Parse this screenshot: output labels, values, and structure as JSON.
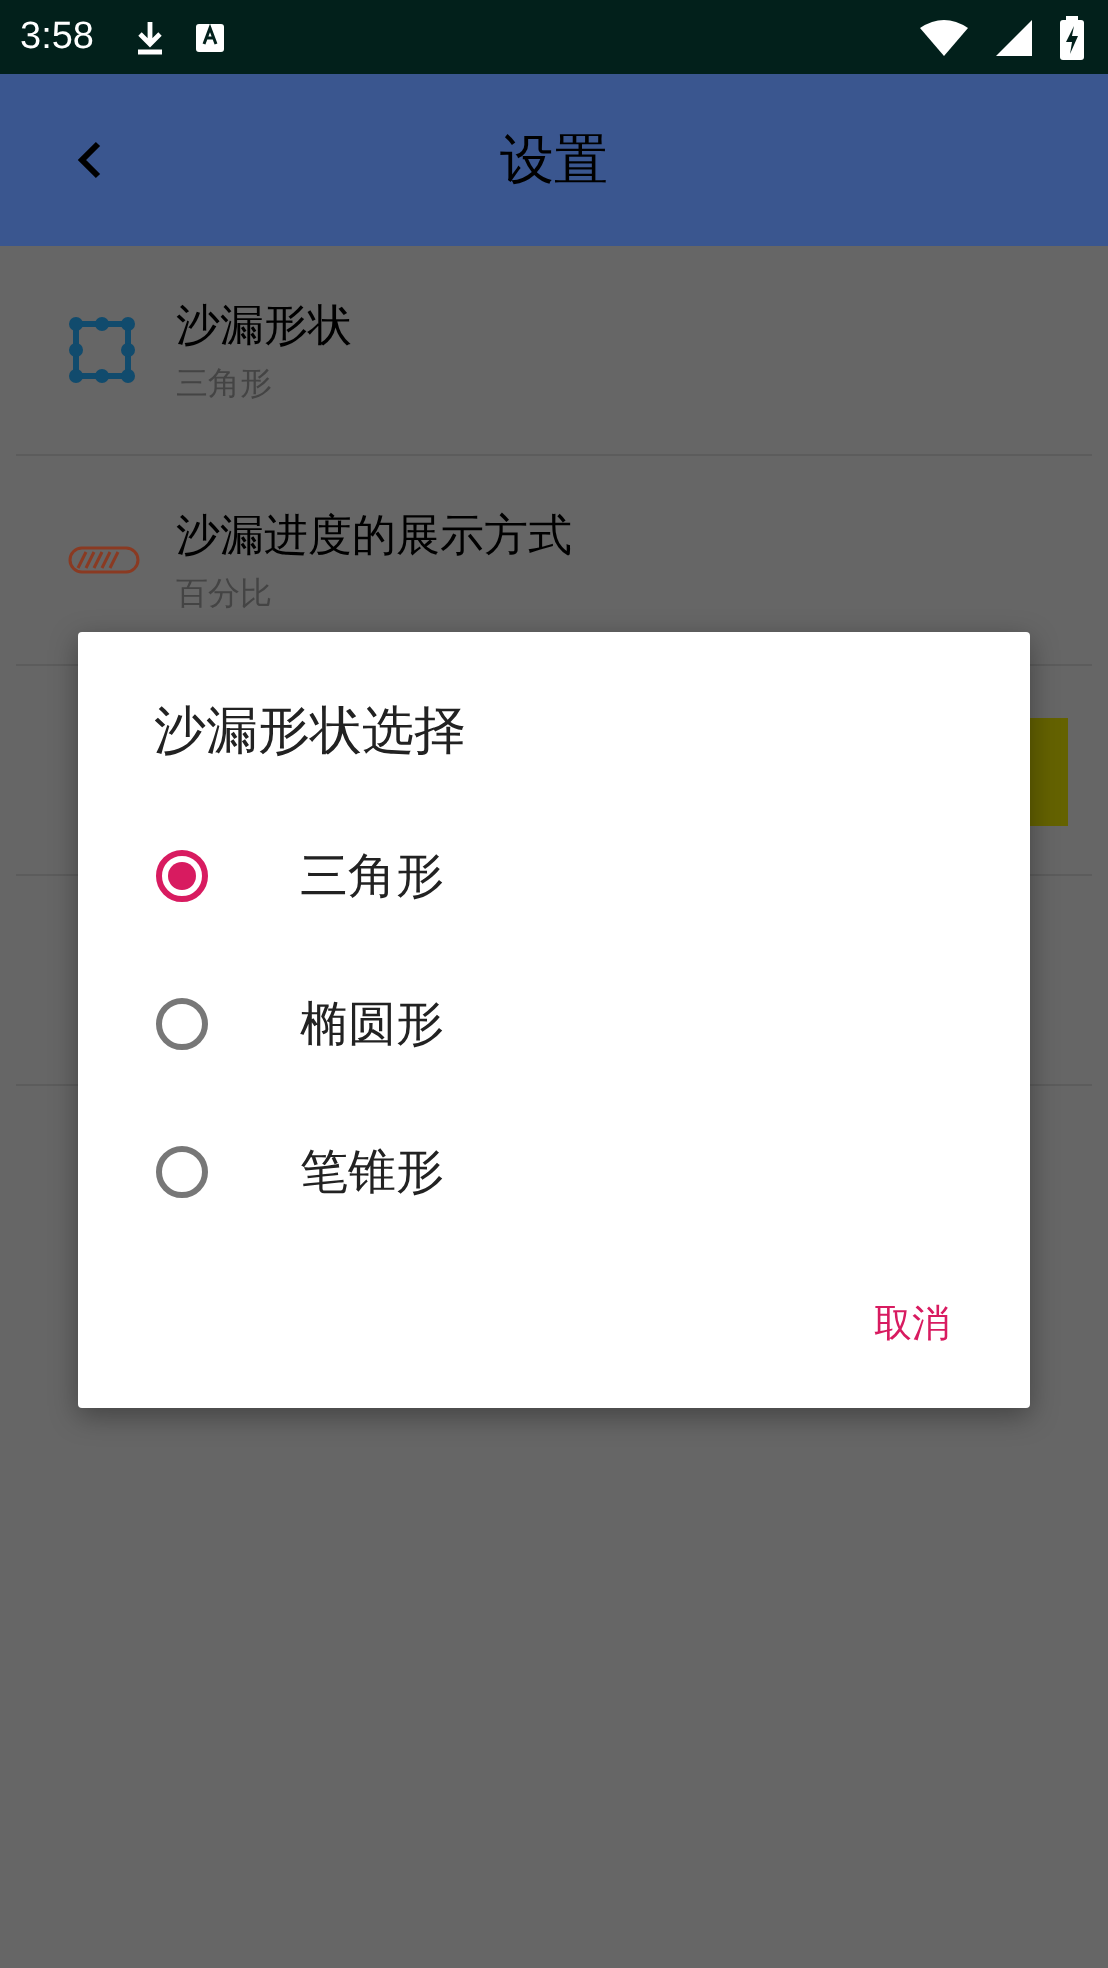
{
  "status_bar": {
    "time": "3:58"
  },
  "app_bar": {
    "title": "设置"
  },
  "settings": [
    {
      "title": "沙漏形状",
      "summary": "三角形",
      "kind": "shape"
    },
    {
      "title": "沙漏进度的展示方式",
      "summary": "百分比",
      "kind": "progress"
    }
  ],
  "dialog": {
    "title": "沙漏形状选择",
    "options": [
      {
        "label": "三角形",
        "selected": true
      },
      {
        "label": "椭圆形",
        "selected": false
      },
      {
        "label": "笔锥形",
        "selected": false
      }
    ],
    "buttons": [
      "取消"
    ]
  }
}
